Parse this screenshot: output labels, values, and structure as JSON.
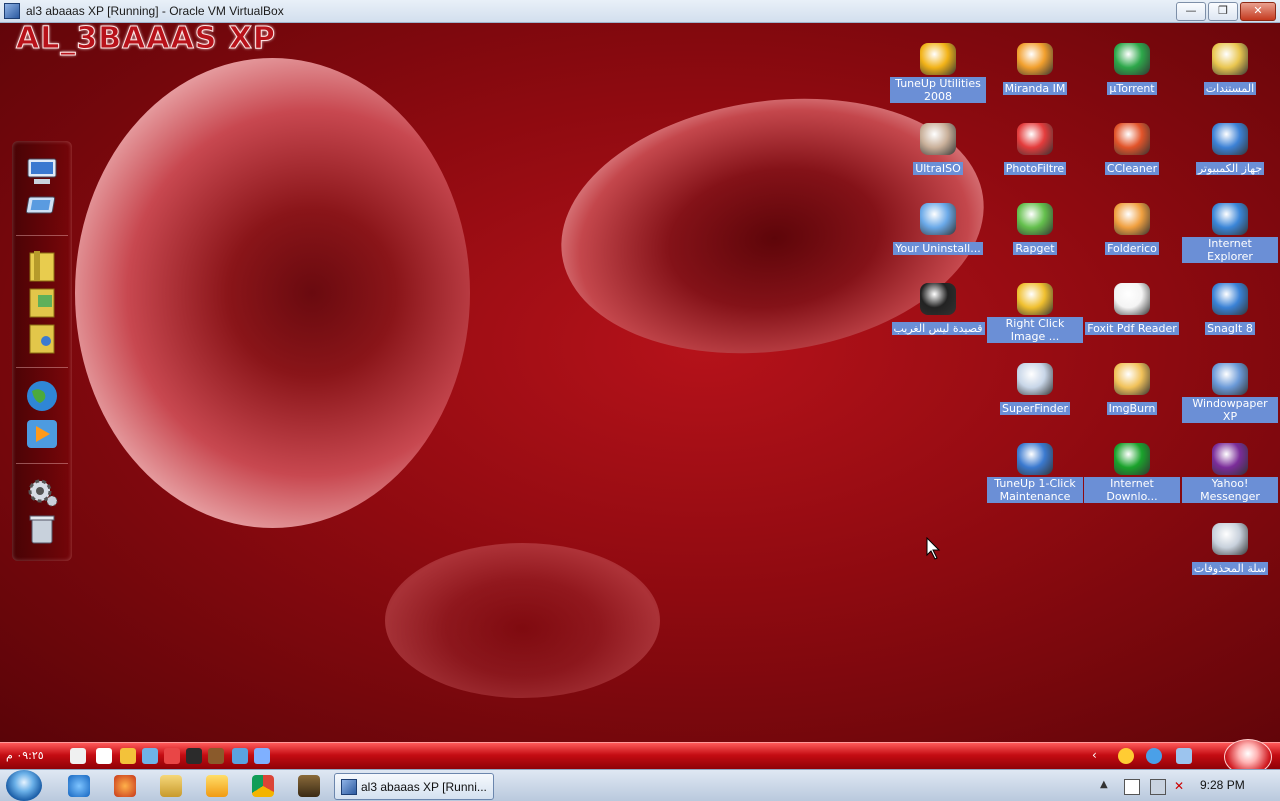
{
  "host_window": {
    "title": "al3 abaaas XP [Running] - Oracle VM VirtualBox",
    "buttons": {
      "minimize": "—",
      "restore": "❐",
      "close": "✕"
    }
  },
  "guest": {
    "brand": "AL_3BAAAS XP",
    "desktop_icons": [
      {
        "label": "TuneUp Utilities 2008",
        "icon": "tuneup-icon"
      },
      {
        "label": "Miranda IM",
        "icon": "miranda-icon"
      },
      {
        "label": "µTorrent",
        "icon": "utorrent-icon"
      },
      {
        "label": "المستندات",
        "icon": "documents-folder-icon"
      },
      {
        "label": "UltraISO",
        "icon": "ultraiso-icon"
      },
      {
        "label": "PhotoFiltre",
        "icon": "photofiltre-icon"
      },
      {
        "label": "CCleaner",
        "icon": "ccleaner-icon"
      },
      {
        "label": "جهاز الكمبيوتر",
        "icon": "my-computer-icon"
      },
      {
        "label": "Your Uninstall...",
        "icon": "uninstaller-icon"
      },
      {
        "label": "Rapget",
        "icon": "rapget-icon"
      },
      {
        "label": "Folderico",
        "icon": "folderico-icon"
      },
      {
        "label": "Internet Explorer",
        "icon": "internet-explorer-icon"
      },
      {
        "label": "قصيدة ليس الغريب",
        "icon": "realplayer-icon"
      },
      {
        "label": "Right Click Image ...",
        "icon": "right-click-image-icon"
      },
      {
        "label": "Foxit Pdf Reader",
        "icon": "foxit-icon"
      },
      {
        "label": "SnagIt 8",
        "icon": "snagit-icon"
      },
      {
        "label": "SuperFinder",
        "icon": "superfinder-icon"
      },
      {
        "label": "ImgBurn",
        "icon": "imgburn-icon"
      },
      {
        "label": "Windowpaper XP",
        "icon": "windowpaper-icon"
      },
      {
        "label": "TuneUp 1-Click Maintenance",
        "icon": "tuneup-maintenance-icon"
      },
      {
        "label": "Internet Downlo...",
        "icon": "idm-icon"
      },
      {
        "label": "Yahoo! Messenger",
        "icon": "yahoo-messenger-icon"
      },
      {
        "label": "سلة المحذوفات",
        "icon": "recycle-bin-icon"
      }
    ],
    "taskbar_clock": "٠٩:٢٥ م"
  },
  "host_taskbar": {
    "active_task": "al3 abaaas XP [Runni...",
    "clock": "9:28 PM",
    "pinned": [
      "internet-explorer-icon",
      "firefox-icon",
      "explorer-icon",
      "media-player-icon",
      "chrome-icon",
      "app-icon"
    ]
  }
}
